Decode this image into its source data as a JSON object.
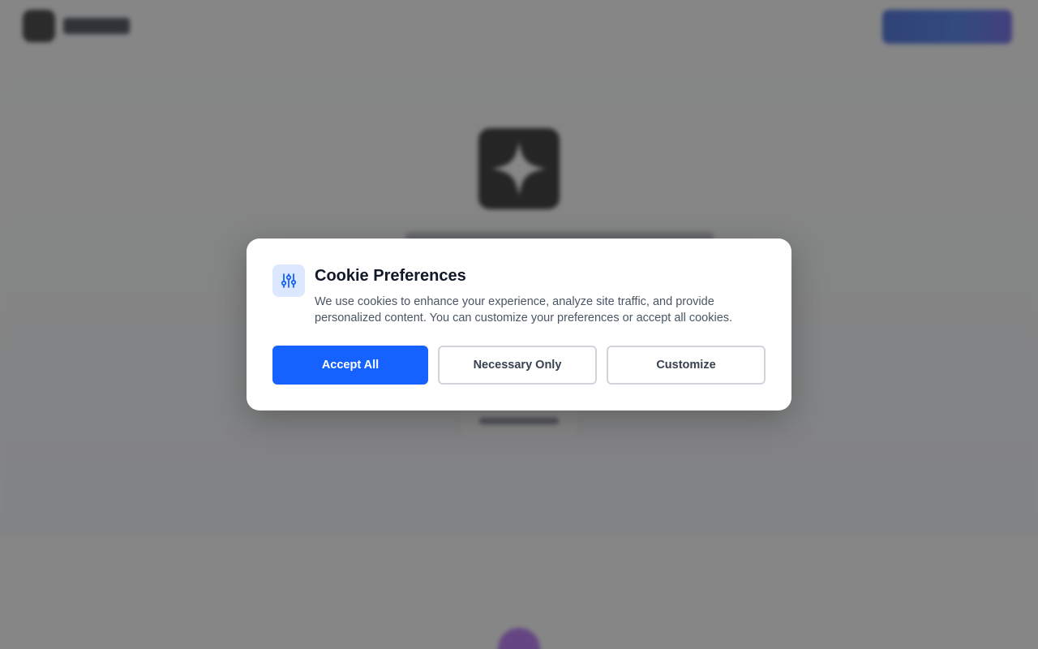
{
  "cookie_modal": {
    "title": "Cookie Preferences",
    "description": "We use cookies to enhance your experience, analyze site traffic, and provide personalized content. You can customize your preferences or accept all cookies.",
    "icon": "sliders-icon",
    "buttons": {
      "accept_all": "Accept All",
      "necessary_only": "Necessary Only",
      "customize": "Customize"
    }
  },
  "colors": {
    "primary": "#1662fe",
    "overlay": "#3c3c3c",
    "icon_bg": "#dbe8fe",
    "title": "#111827",
    "body": "#4b5563"
  }
}
